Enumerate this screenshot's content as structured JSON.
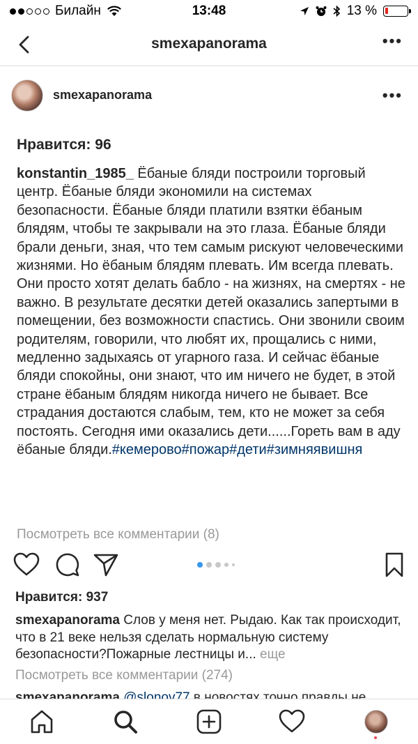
{
  "status_bar": {
    "carrier": "Билайн",
    "time": "13:48",
    "battery_percent": "13 %",
    "battery_level": 0.13
  },
  "nav": {
    "title": "smexapanorama"
  },
  "post": {
    "username": "smexapanorama",
    "likes": "Нравится: 96",
    "caption_author": "konstantin_1985_",
    "caption_text": " Ёбаные бляди построили торговый центр. Ёбаные бляди экономили на системах безопасности. Ёбаные бляди платили взятки ёбаным блядям, чтобы те закрывали на это глаза. Ёбаные бляди брали деньги, зная, что тем самым рискуют человеческими жизнями. Но ёбаным блядям плевать. Им всегда плевать. Они просто хотят делать бабло - на жизнях, на смертях - не важно. В результате десятки детей оказались запертыми в помещении, без возможности спастись. Они звонили своим родителям, говорили, что любят их, прощались с ними, медленно задыхаясь от угарного газа. И сейчас ёбаные бляди спокойны, они знают, что им ничего не будет, в этой стране ёбаным блядям никогда ничего не бывает. Все страдания достаются слабым, тем, кто не может за себя постоять. Сегодня ими оказались дети......Гореть вам в аду ёбаные бляди.",
    "hashtags": "#кемерово#пожар#дети#зимняявишня",
    "view_comments": "Посмотреть все комментарии (8)"
  },
  "feed": {
    "likes": "Нравится: 937",
    "comment_author": "smexapanorama",
    "comment_text": " Слов у меня нет. Рыдаю. Как так происходит, что в 21 веке нельзя сделать нормальную систему безопасности?Пожарные лестницы и...",
    "more": " еще",
    "view_comments": "Посмотреть все комментарии (274)",
    "partial_author": "smexapanorama",
    "partial_mention": " @slonov77",
    "partial_text": " в новостях точно правды не"
  },
  "icons": {
    "back": "chevron-left-icon",
    "more": "ellipsis-icon",
    "like": "heart-icon",
    "comment": "comment-icon",
    "share": "send-icon",
    "save": "bookmark-icon",
    "home": "home-icon",
    "search": "search-icon",
    "add": "add-post-icon",
    "activity": "heart-icon",
    "profile": "profile-avatar"
  },
  "colors": {
    "hashtag": "#003569",
    "muted": "#999999",
    "active_dot": "#3897f0",
    "battery_low": "#e0281f"
  }
}
